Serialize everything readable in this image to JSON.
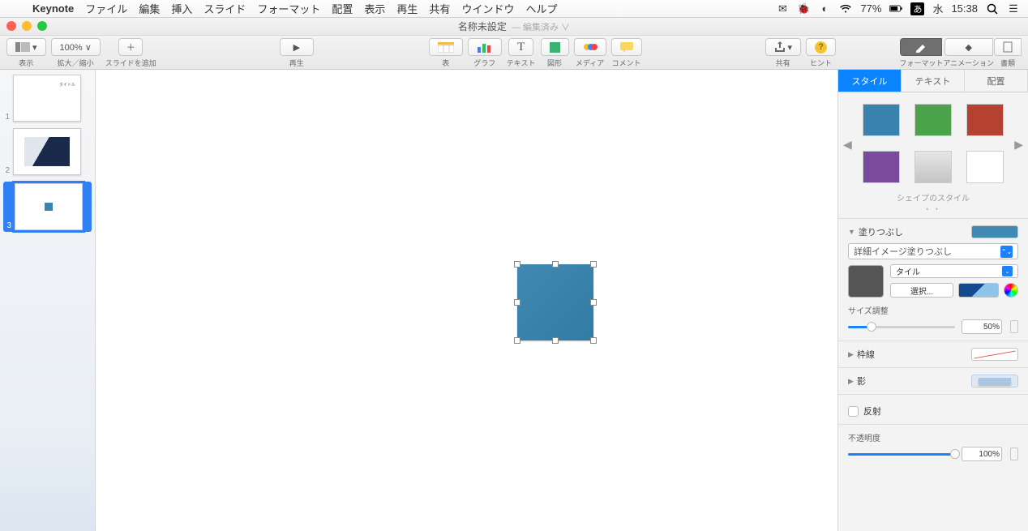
{
  "menubar": {
    "app": "Keynote",
    "items": [
      "ファイル",
      "編集",
      "挿入",
      "スライド",
      "フォーマット",
      "配置",
      "表示",
      "再生",
      "共有",
      "ウインドウ",
      "ヘルプ"
    ],
    "battery": "77%",
    "ime": "あ",
    "day": "水",
    "time": "15:38"
  },
  "window": {
    "title": "名称未設定",
    "edited": "— 編集済み ∨"
  },
  "toolbar": {
    "view": "表示",
    "zoom_value": "100% ∨",
    "zoom_label": "拡大／縮小",
    "add_slide": "スライドを追加",
    "play": "再生",
    "table": "表",
    "chart": "グラフ",
    "text": "テキスト",
    "shape": "図形",
    "media": "メディア",
    "comment": "コメント",
    "share": "共有",
    "hint": "ヒント",
    "format": "フォーマット",
    "animation": "アニメーション",
    "document": "書類"
  },
  "nav": {
    "slides": [
      "1",
      "2",
      "3"
    ]
  },
  "inspector": {
    "tabs": {
      "style": "スタイル",
      "text": "テキスト",
      "arrange": "配置"
    },
    "shape_styles_label": "シェイプのスタイル",
    "fill": {
      "title": "塗りつぶし",
      "type": "詳細イメージ塗りつぶし",
      "tile": "タイル",
      "choose": "選択...",
      "size_label": "サイズ調整",
      "size_value": "50%"
    },
    "border": "枠線",
    "shadow": "影",
    "reflection": "反射",
    "opacity_label": "不透明度",
    "opacity_value": "100%"
  }
}
